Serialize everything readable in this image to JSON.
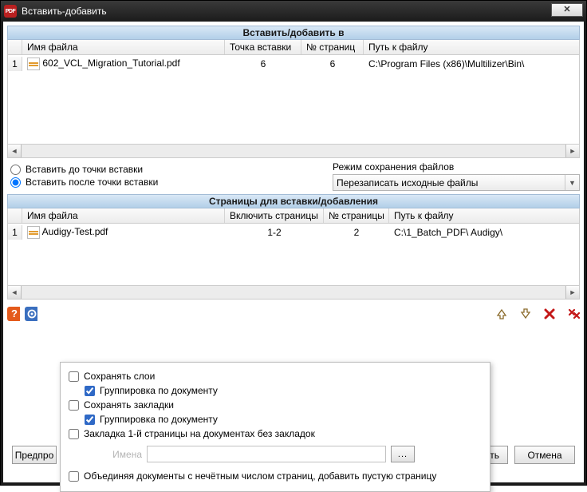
{
  "window": {
    "title": "Вставить-добавить"
  },
  "section1": {
    "header": "Вставить/добавить в",
    "cols": {
      "name": "Имя файла",
      "point": "Точка вставки",
      "pages": "№ страниц",
      "path": "Путь к файлу"
    },
    "rows": [
      {
        "num": "1",
        "name": "602_VCL_Migration_Tutorial.pdf",
        "point": "6",
        "pages": "6",
        "path": "C:\\Program Files (x86)\\Multilizer\\Bin\\"
      }
    ]
  },
  "insert_opts": {
    "before": "Вставить до точки вставки",
    "after": "Вставить после точки вставки"
  },
  "save_mode": {
    "label": "Режим сохранения файлов",
    "value": "Перезаписать исходные файлы"
  },
  "section2": {
    "header": "Страницы для вставки/добавления",
    "cols": {
      "name": "Имя файла",
      "include": "Включить страницы",
      "pages": "№ страницы",
      "path": "Путь к файлу"
    },
    "rows": [
      {
        "num": "1",
        "name": "Audigy-Test.pdf",
        "include": "1-2",
        "pages": "2",
        "path": "C:\\1_Batch_PDF\\ Audigy\\"
      }
    ]
  },
  "popup": {
    "keep_layers": "Сохранять слои",
    "group_by_doc": "Группировка по документу",
    "keep_bookmarks": "Сохранять закладки",
    "group_by_doc2": "Группировка по документу",
    "bm_first_page": "Закладка 1-й страницы на документах без закладок",
    "names_label": "Имена",
    "names_btn": "...",
    "pad_odd": "Объединяя документы с нечётным числом страниц, добавить пустую страницу"
  },
  "buttons": {
    "preview": "Предпро",
    "execute": "ыполнить",
    "cancel": "Отмена"
  }
}
